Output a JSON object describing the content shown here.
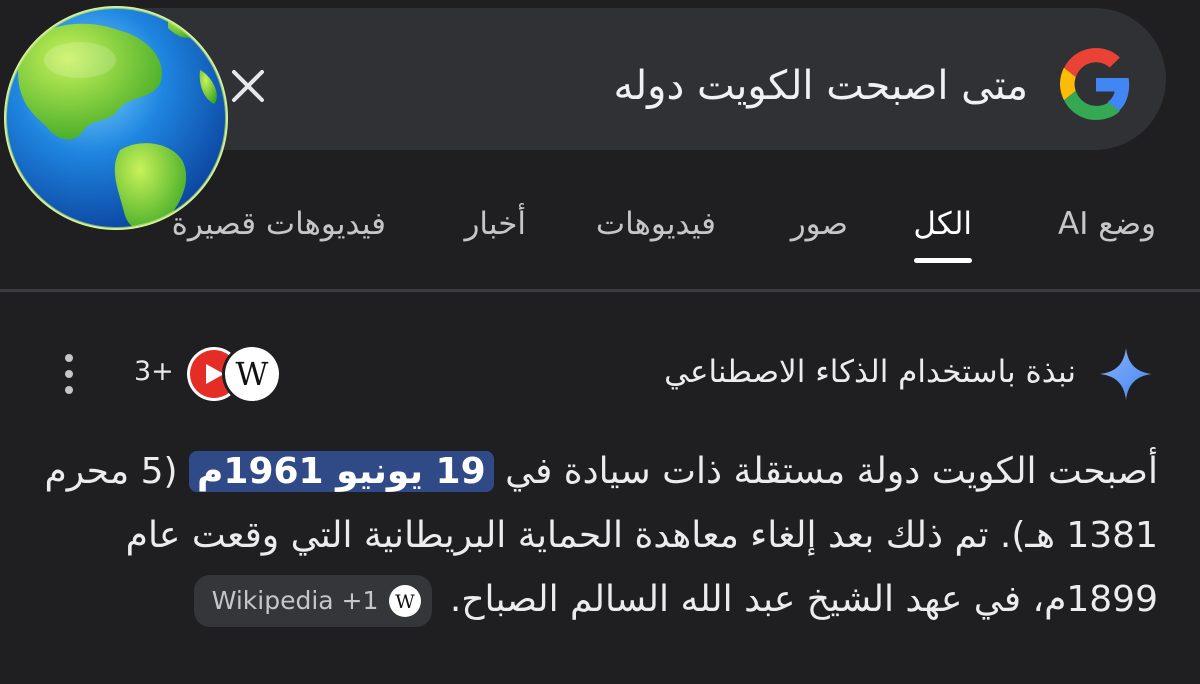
{
  "search": {
    "query": "متى اصبحت الكويت دوله",
    "logo_icon": "google-g-icon",
    "clear_icon": "close-icon"
  },
  "overlay_icon": "globe-icon",
  "tabs": [
    {
      "label": "وضع AI",
      "active": false
    },
    {
      "label": "الكل",
      "active": true
    },
    {
      "label": "صور",
      "active": false
    },
    {
      "label": "فيديوهات",
      "active": false
    },
    {
      "label": "أخبار",
      "active": false
    },
    {
      "label": "فيديوهات قصيرة",
      "active": false
    }
  ],
  "ai_overview": {
    "title": "نبذة باستخدام الذكاء الاصطناعي",
    "icon": "sparkle-icon",
    "sources_count": "3+",
    "source_icons": [
      "wikipedia-icon",
      "youtube-icon"
    ],
    "answer": {
      "before": "أصبحت الكويت دولة مستقلة ذات سيادة في",
      "highlight": "19 يونيو 1961م",
      "after": "(5 محرم 1381 هـ). تم ذلك بعد إلغاء معاهدة الحماية البريطانية التي وقعت عام 1899م، في عهد الشيخ عبد الله السالم الصباح."
    },
    "citation": {
      "label": "Wikipedia +1",
      "icon": "wikipedia-icon"
    }
  },
  "colors": {
    "background": "#1f1f21",
    "search_bg": "#303134",
    "highlight": "#2f4a86",
    "chip_bg": "#35363a"
  }
}
